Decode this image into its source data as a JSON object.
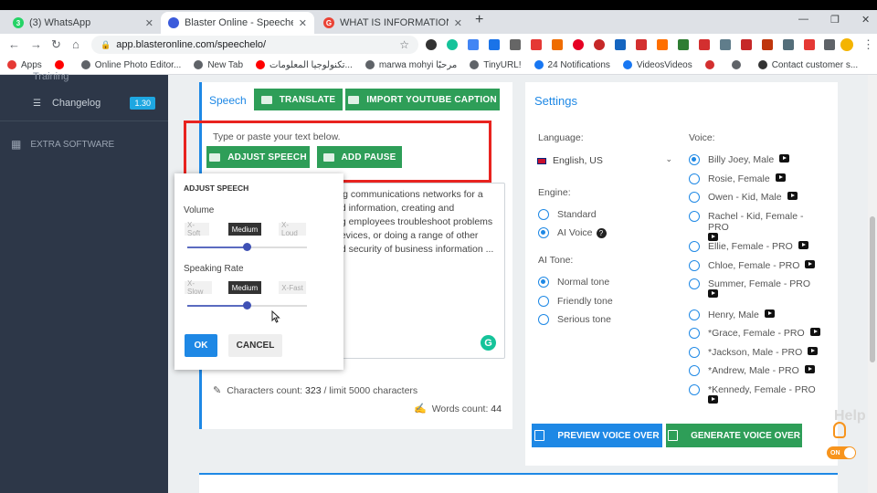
{
  "browser": {
    "tabs": [
      {
        "title": "(3) WhatsApp",
        "fav_color": "#25d366",
        "fav_text": "3"
      },
      {
        "title": "Blaster Online - Speechelo",
        "fav_color": "#3b5bdb",
        "fav_text": ""
      },
      {
        "title": "WHAT IS INFORMATION TECHNO",
        "fav_color": "#ea4335",
        "fav_text": "G"
      }
    ],
    "url": "app.blasteronline.com/speechelo/",
    "bookmarks": [
      {
        "label": "Apps",
        "color": "#e53935"
      },
      {
        "label": "",
        "color": "#ff0000"
      },
      {
        "label": "Online Photo Editor...",
        "color": "#5f6368"
      },
      {
        "label": "New Tab",
        "color": "#5f6368"
      },
      {
        "label": "تكنولوجيا المعلومات...",
        "color": "#ff0000"
      },
      {
        "label": "marwa mohyi مرحبًا",
        "color": "#5f6368"
      },
      {
        "label": "TinyURL!",
        "color": "#5f6368"
      },
      {
        "label": "24 Notifications",
        "color": "#1877f2"
      },
      {
        "label": "VideosVideos",
        "color": "#1877f2"
      },
      {
        "label": "",
        "color": "#d32f2f"
      },
      {
        "label": "",
        "color": "#5f6368"
      },
      {
        "label": "Contact customer s...",
        "color": "#333333"
      }
    ]
  },
  "sidebar": {
    "partial_item": "Training",
    "changelog_label": "Changelog",
    "changelog_badge": "1.30",
    "extra_software": "EXTRA SOFTWARE"
  },
  "editor": {
    "section_title": "Speech",
    "translate_label": "TRANSLATE",
    "import_label": "IMPORT YOUTUBE CAPTION",
    "hint": "Type or paste your text below.",
    "adjust_speech_label": "ADJUST SPEECH",
    "add_pause_label": "ADD PAUSE",
    "text_lines": [
      "ing communications networks for a",
      "nd information, creating and",
      "ng employees troubleshoot problems",
      " devices, or doing a range of other",
      "nd security of business information ..."
    ],
    "characters_label": "Characters count:",
    "characters_count": "323",
    "characters_limit": "/ limit 5000 characters",
    "words_label": "Words count:",
    "words_count": "44"
  },
  "adjust_popup": {
    "title": "ADJUST SPEECH",
    "volume_label": "Volume",
    "volume_levels": [
      "X-Soft",
      "Medium",
      "X-Loud"
    ],
    "volume_value": 0.5,
    "rate_label": "Speaking Rate",
    "rate_levels": [
      "X-Slow",
      "Medium",
      "X-Fast"
    ],
    "rate_value": 0.5,
    "ok_label": "OK",
    "cancel_label": "CANCEL"
  },
  "settings": {
    "title": "Settings",
    "language_label": "Language:",
    "language_value": "English, US",
    "engine_label": "Engine:",
    "engine_options": [
      {
        "label": "Standard",
        "selected": false
      },
      {
        "label": "AI Voice",
        "selected": true
      }
    ],
    "tone_label": "AI Tone:",
    "tone_options": [
      {
        "label": "Normal tone",
        "selected": true
      },
      {
        "label": "Friendly tone",
        "selected": false
      },
      {
        "label": "Serious tone",
        "selected": false
      }
    ],
    "voice_label": "Voice:",
    "voices": [
      {
        "label": "Billy Joey, Male",
        "selected": true
      },
      {
        "label": "Rosie, Female",
        "selected": false
      },
      {
        "label": "Owen - Kid, Male",
        "selected": false
      },
      {
        "label": "Rachel - Kid, Female - PRO",
        "selected": false
      },
      {
        "label": "Ellie, Female - PRO",
        "selected": false
      },
      {
        "label": "Chloe, Female - PRO",
        "selected": false
      },
      {
        "label": "Summer, Female - PRO",
        "selected": false
      },
      {
        "label": "Henry, Male",
        "selected": false
      },
      {
        "label": "*Grace, Female - PRO",
        "selected": false
      },
      {
        "label": "*Jackson, Male - PRO",
        "selected": false
      },
      {
        "label": "*Andrew, Male - PRO",
        "selected": false
      },
      {
        "label": "*Kennedy, Female - PRO",
        "selected": false
      }
    ],
    "preview_label": "PREVIEW VOICE OVER",
    "generate_label": "GENERATE VOICE OVER"
  },
  "help_widget": {
    "label": "Help",
    "toggle": "ON"
  }
}
